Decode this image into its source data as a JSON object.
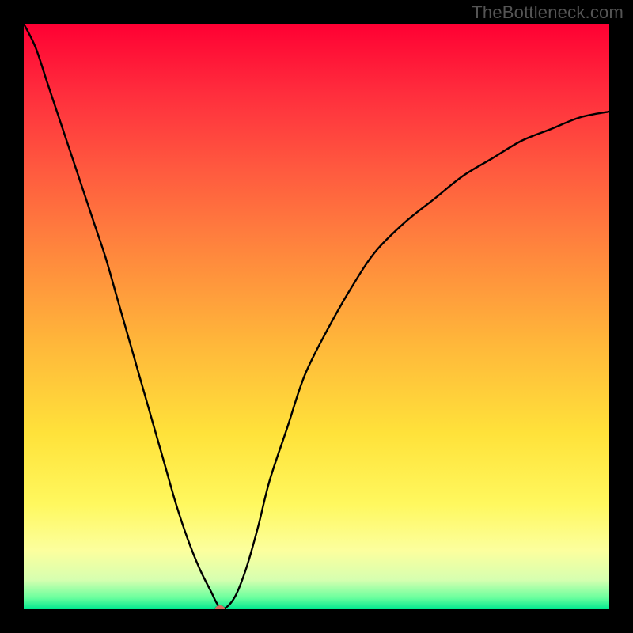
{
  "watermark": "TheBottleneck.com",
  "colors": {
    "frame": "#000000",
    "curve": "#000000",
    "min_dot": "#d86b5e",
    "gradient_stops": [
      "#ff0033",
      "#ff2e3d",
      "#ff5a3f",
      "#ff8a3d",
      "#ffb83a",
      "#ffe23a",
      "#fff85e",
      "#fcff9e",
      "#d6ffb0",
      "#6cff9e",
      "#00e890"
    ]
  },
  "chart_data": {
    "type": "line",
    "title": "",
    "xlabel": "",
    "ylabel": "",
    "xlim": [
      0,
      100
    ],
    "ylim": [
      0,
      100
    ],
    "grid": false,
    "legend": false,
    "x": [
      0,
      2,
      4,
      6,
      8,
      10,
      12,
      14,
      16,
      18,
      20,
      22,
      24,
      26,
      28,
      30,
      32,
      33,
      34,
      36,
      38,
      40,
      42,
      45,
      48,
      52,
      56,
      60,
      65,
      70,
      75,
      80,
      85,
      90,
      95,
      100
    ],
    "values": [
      100,
      96,
      90,
      84,
      78,
      72,
      66,
      60,
      53,
      46,
      39,
      32,
      25,
      18,
      12,
      7,
      3,
      1,
      0,
      2,
      7,
      14,
      22,
      31,
      40,
      48,
      55,
      61,
      66,
      70,
      74,
      77,
      80,
      82,
      84,
      85
    ],
    "minimum": {
      "x": 33.5,
      "y": 0
    }
  }
}
